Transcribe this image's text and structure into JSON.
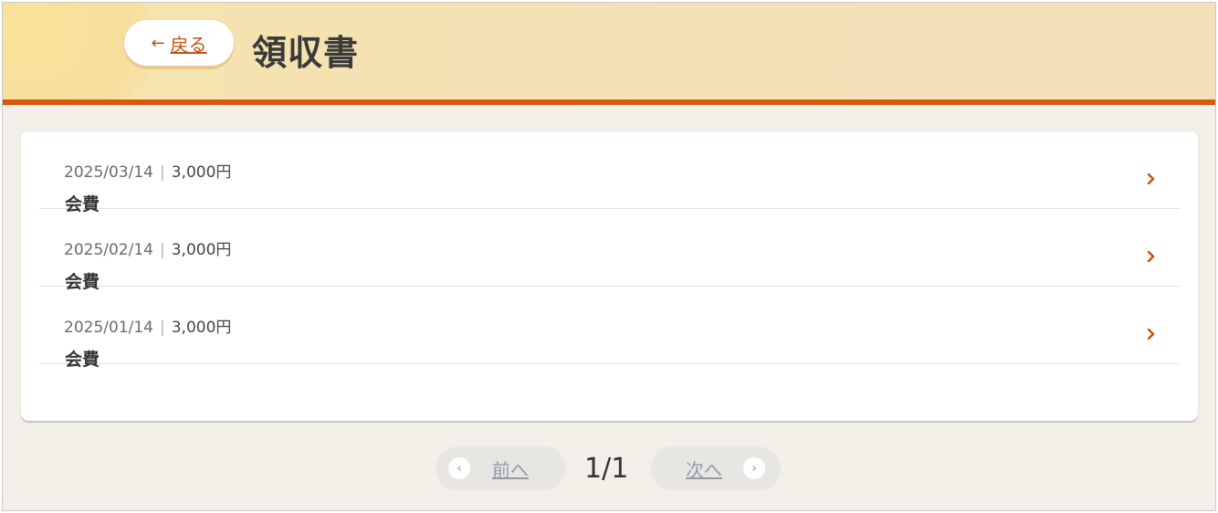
{
  "header": {
    "back_label": "戻る",
    "back_arrow": "←",
    "title": "領収書",
    "accent_color": "#d45a10"
  },
  "receipts": [
    {
      "date": "2025/03/14",
      "separator": "|",
      "amount": "3,000円",
      "name": "会費",
      "icon": "chevron-right-icon"
    },
    {
      "date": "2025/02/14",
      "separator": "|",
      "amount": "3,000円",
      "name": "会費",
      "icon": "chevron-right-icon"
    },
    {
      "date": "2025/01/14",
      "separator": "|",
      "amount": "3,000円",
      "name": "会費",
      "icon": "chevron-right-icon"
    }
  ],
  "pagination": {
    "prev_label": "前へ",
    "next_label": "次へ",
    "page_indicator": "1/1",
    "prev_icon": "chevron-left-icon",
    "next_icon": "chevron-right-icon",
    "prev_glyph": "‹",
    "next_glyph": "›"
  }
}
